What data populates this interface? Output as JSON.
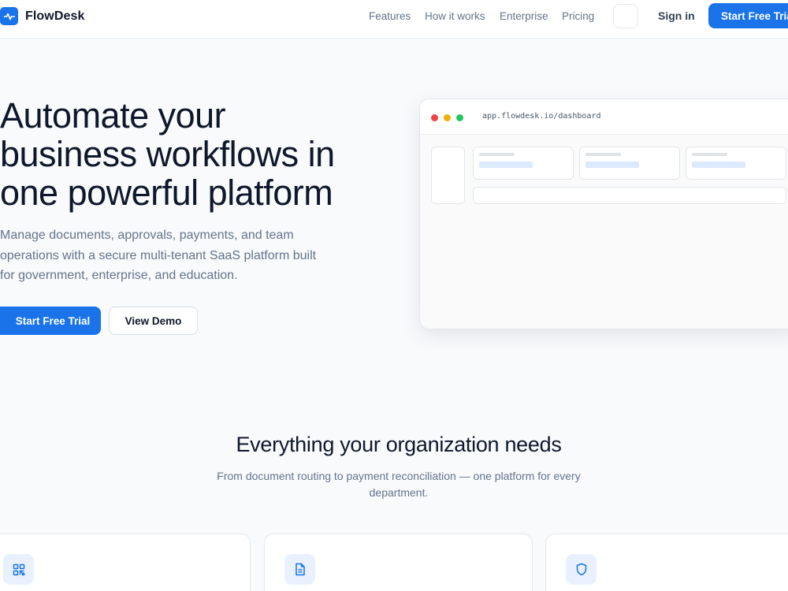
{
  "brand": {
    "name": "FlowDesk",
    "logo_icon": "pulse-icon",
    "accent": "#1a73e8"
  },
  "nav": {
    "links": [
      "Features",
      "How it works",
      "Enterprise",
      "Pricing"
    ],
    "sign_in": "Sign in",
    "cta": "Start Free Trial"
  },
  "hero": {
    "title_lines": [
      "Automate your",
      "business workflows in",
      "one powerful platform"
    ],
    "subtitle_lines": [
      "Manage documents, approvals, payments, and team",
      "operations with a secure multi-tenant SaaS platform built",
      "for government, enterprise, and education."
    ],
    "primary_button": "Start Free Trial",
    "secondary_button": "View Demo"
  },
  "mock_browser": {
    "url": "app.flowdesk.io/dashboard",
    "dot_colors": [
      "#ef4444",
      "#eab308",
      "#22c55e"
    ]
  },
  "features": {
    "title": "Everything your organization needs",
    "subtitle_lines": [
      "From document routing to payment reconciliation — one platform for every",
      "department."
    ],
    "cards": [
      {
        "icon": "grid-icon"
      },
      {
        "icon": "document-icon"
      },
      {
        "icon": "shield-icon"
      }
    ]
  }
}
